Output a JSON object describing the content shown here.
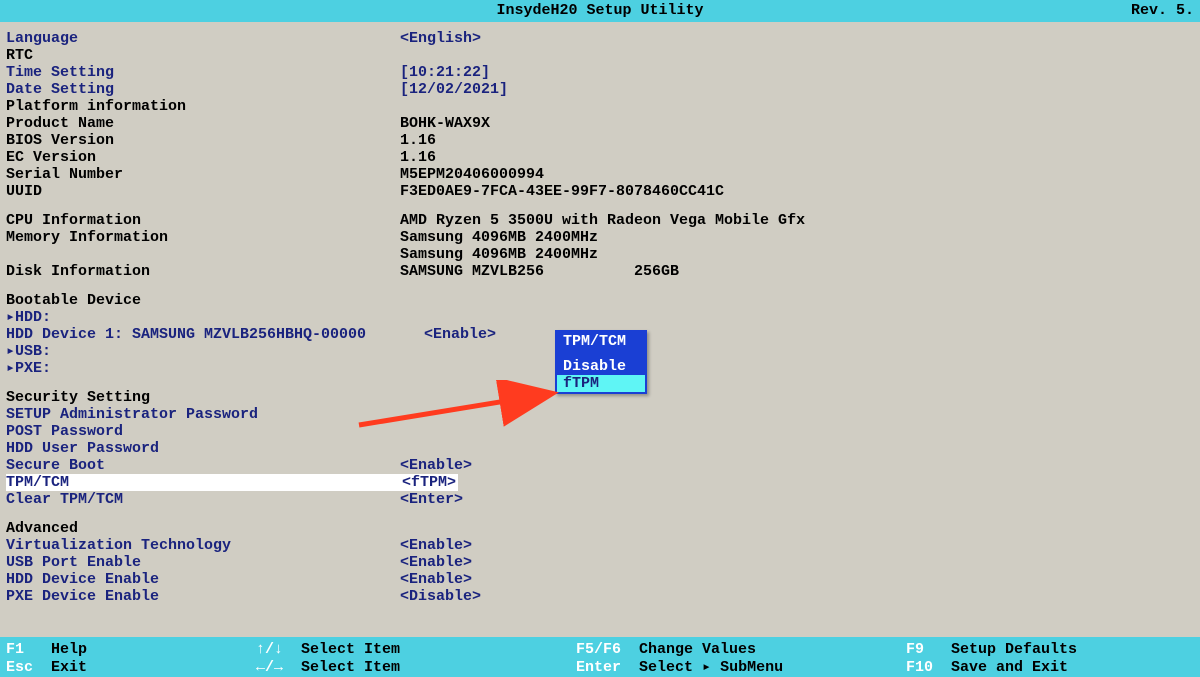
{
  "header": {
    "title": "InsydeH20 Setup Utility",
    "rev": "Rev. 5."
  },
  "info": {
    "language": {
      "label": "Language",
      "value": "<English>"
    },
    "rtc": {
      "label": "RTC"
    },
    "time": {
      "label": "Time Setting",
      "value": "[10:21:22]"
    },
    "date": {
      "label": "Date Setting",
      "value": "[12/02/2021]"
    },
    "platform": {
      "label": "Platform information"
    },
    "product": {
      "label": "Product Name",
      "value": "BOHK-WAX9X"
    },
    "bios": {
      "label": "BIOS Version",
      "value": "1.16"
    },
    "ec": {
      "label": "EC Version",
      "value": "1.16"
    },
    "serial": {
      "label": "Serial Number",
      "value": "M5EPM20406000994"
    },
    "uuid": {
      "label": "UUID",
      "value": "F3ED0AE9-7FCA-43EE-99F7-8078460CC41C"
    },
    "cpu": {
      "label": "CPU Information",
      "value": "AMD Ryzen 5 3500U with Radeon Vega Mobile Gfx"
    },
    "mem": {
      "label": "Memory Information",
      "value": "Samsung 4096MB 2400MHz",
      "value2": "Samsung 4096MB 2400MHz"
    },
    "disk": {
      "label": "Disk Information",
      "value_a": "SAMSUNG MZVLB256",
      "value_b": " 256GB"
    }
  },
  "boot": {
    "section": "Bootable Device",
    "hdd": "▸HDD:",
    "hdd1": {
      "label": "HDD Device 1: SAMSUNG MZVLB256HBHQ-00000",
      "value": "<Enable>"
    },
    "usb": "▸USB:",
    "pxe": "▸PXE:"
  },
  "security": {
    "section": "Security Setting",
    "admin": "SETUP Administrator Password",
    "post": "POST Password",
    "hdduser": "HDD User Password",
    "secureboot": {
      "label": "Secure Boot",
      "value": "<Enable>"
    },
    "tpm": {
      "label": "TPM/TCM",
      "value": "<fTPM>"
    },
    "clear": {
      "label": "Clear TPM/TCM",
      "value": "<Enter>"
    }
  },
  "advanced": {
    "section": "Advanced",
    "virt": {
      "label": "Virtualization Technology",
      "value": "<Enable>"
    },
    "usb": {
      "label": "USB Port Enable",
      "value": "<Enable>"
    },
    "hdd": {
      "label": "HDD Device Enable",
      "value": "<Enable>"
    },
    "pxe": {
      "label": "PXE Device Enable",
      "value": "<Disable>"
    }
  },
  "popup": {
    "title": "TPM/TCM",
    "options": [
      "Disable",
      "fTPM"
    ],
    "selected": 1
  },
  "footer": {
    "f1": {
      "key": "F1",
      "text": "Help"
    },
    "esc": {
      "key": "Esc",
      "text": "Exit"
    },
    "updown": {
      "key": "↑/↓",
      "text": "Select Item"
    },
    "leftright": {
      "key": "←/→",
      "text": "Select Item"
    },
    "f5f6": {
      "key": "F5/F6",
      "text": "Change Values"
    },
    "enter": {
      "key": "Enter",
      "text": "Select ▸ SubMenu"
    },
    "f9": {
      "key": "F9",
      "text": "Setup Defaults"
    },
    "f10": {
      "key": "F10",
      "text": "Save and Exit"
    }
  }
}
